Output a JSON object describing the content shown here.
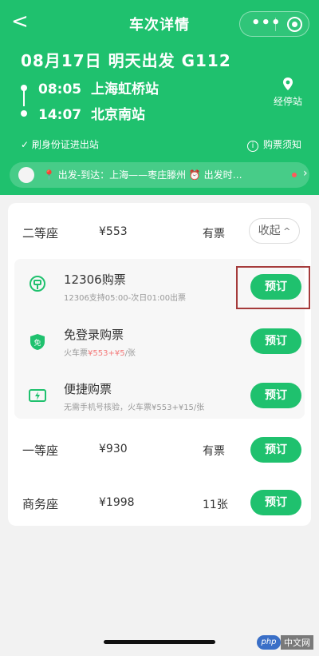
{
  "header": {
    "title": "车次详情",
    "menu_glyph": "•••",
    "trip_title": "08月17日 明天出发 G112",
    "departure": {
      "time": "08:05",
      "station": "上海虹桥站"
    },
    "arrival": {
      "time": "14:07",
      "station": "北京南站"
    },
    "stations_label": "经停站",
    "id_tag": "✓ 刷身份证进出站",
    "notice_label": "购票须知",
    "banner_text": "📍 出发-到达：上海——枣庄滕州 ⏰ 出发时…",
    "accent_color": "#1fc16e"
  },
  "seats": {
    "second": {
      "label": "二等座",
      "price": "¥553",
      "availability": "有票",
      "collapse_label": "收起"
    },
    "first": {
      "label": "一等座",
      "price": "¥930",
      "availability": "有票",
      "book_label": "预订"
    },
    "business": {
      "label": "商务座",
      "price": "¥1998",
      "availability": "11张",
      "book_label": "预订"
    }
  },
  "options": [
    {
      "title": "12306购票",
      "subtitle": "12306支持05:00-次日01:00出票",
      "book_label": "预订",
      "icon": "railway-logo-icon"
    },
    {
      "title": "免登录购票",
      "subtitle_prefix": "火车票",
      "subtitle_red": "¥553+¥5",
      "subtitle_suffix": "/张",
      "book_label": "预订",
      "icon": "shield-mian-icon"
    },
    {
      "title": "便捷购票",
      "subtitle": "无需手机号核验，火车票¥553+¥15/张",
      "book_label": "预订",
      "icon": "ticket-lightning-icon"
    }
  ],
  "watermark": {
    "logo": "php",
    "text": "中文网"
  }
}
